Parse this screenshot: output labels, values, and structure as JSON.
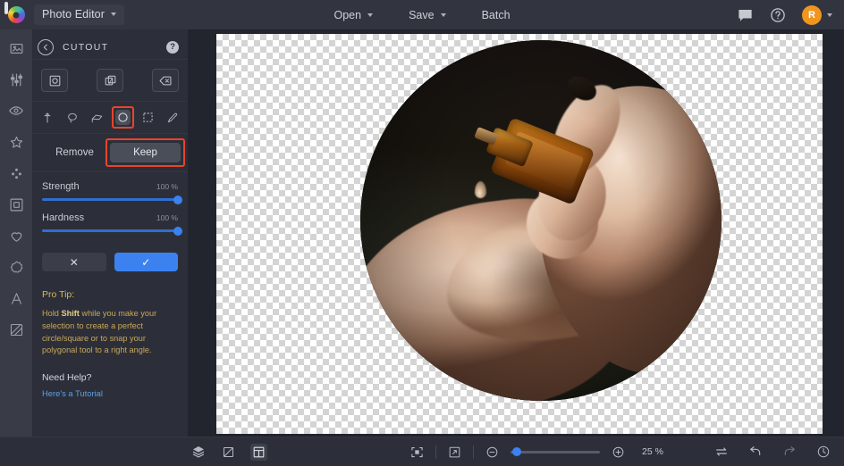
{
  "topbar": {
    "app_title": "Photo Editor",
    "app_caret": "chevron-down",
    "menus": [
      {
        "label": "Open",
        "has_caret": true
      },
      {
        "label": "Save",
        "has_caret": true
      },
      {
        "label": "Batch",
        "has_caret": false
      }
    ],
    "icons": [
      "comment-icon",
      "help-icon"
    ],
    "avatar_initial": "R"
  },
  "rail": {
    "items": [
      {
        "name": "image-icon"
      },
      {
        "name": "adjust-sliders-icon"
      },
      {
        "name": "eye-icon"
      },
      {
        "name": "star-effects-icon"
      },
      {
        "name": "particles-icon"
      },
      {
        "name": "frame-icon"
      },
      {
        "name": "heart-icon"
      },
      {
        "name": "sticker-icon"
      },
      {
        "name": "text-icon"
      },
      {
        "name": "texture-icon"
      }
    ]
  },
  "panel": {
    "title": "CUTOUT",
    "back_label": "←",
    "help_label": "?",
    "modes": [
      {
        "name": "cutout-mode-icon"
      },
      {
        "name": "layers-mode-icon"
      },
      {
        "name": "erase-mode-icon"
      }
    ],
    "tools": [
      {
        "name": "magic-wand-tool"
      },
      {
        "name": "lasso-tool"
      },
      {
        "name": "polygon-tool"
      },
      {
        "name": "ellipse-tool",
        "active": true
      },
      {
        "name": "rectangle-tool"
      },
      {
        "name": "brush-tool"
      }
    ],
    "highlighted_tool": "ellipse-tool",
    "remove_label": "Remove",
    "keep_label": "Keep",
    "selected_mode": "Keep",
    "sliders": [
      {
        "label": "Strength",
        "value": "100 %",
        "percent": 100
      },
      {
        "label": "Hardness",
        "value": "100 %",
        "percent": 100
      }
    ],
    "cancel_label": "✕",
    "confirm_label": "✓",
    "tip_heading": "Pro Tip:",
    "tip_body_pre": "Hold ",
    "tip_body_strong": "Shift",
    "tip_body_post": " while you make your selection to create a perfect circle/square or to snap your polygonal tool to a right angle.",
    "need_help_label": "Need Help?",
    "tutorial_link": "Here's a Tutorial"
  },
  "canvas": {
    "transparent_background": true,
    "image_alt": "hand-holding-essential-oil-bottle-dropping-onto-palm",
    "shape": "circle"
  },
  "bottombar": {
    "left_icons": [
      "layers-icon",
      "crop-icon",
      "compare-icon"
    ],
    "center_icons": [
      "fit-to-screen-icon",
      "fullscreen-icon"
    ],
    "zoom_out_label": "−",
    "zoom_in_label": "+",
    "zoom_value": "25 %",
    "zoom_percent": 25,
    "right_icons": [
      "swap-icon",
      "undo-icon",
      "redo-icon",
      "history-icon"
    ]
  },
  "colors": {
    "accent_blue": "#3b82f0",
    "annotation_red": "#e8442a",
    "avatar_orange": "#f0951f",
    "tip_gold": "#c9a75a",
    "link_blue": "#5f9fe8",
    "topbar_bg": "#32353f",
    "panel_bg": "#2c2f39",
    "rail_bg": "#393c47",
    "stage_bg": "#22252e"
  }
}
